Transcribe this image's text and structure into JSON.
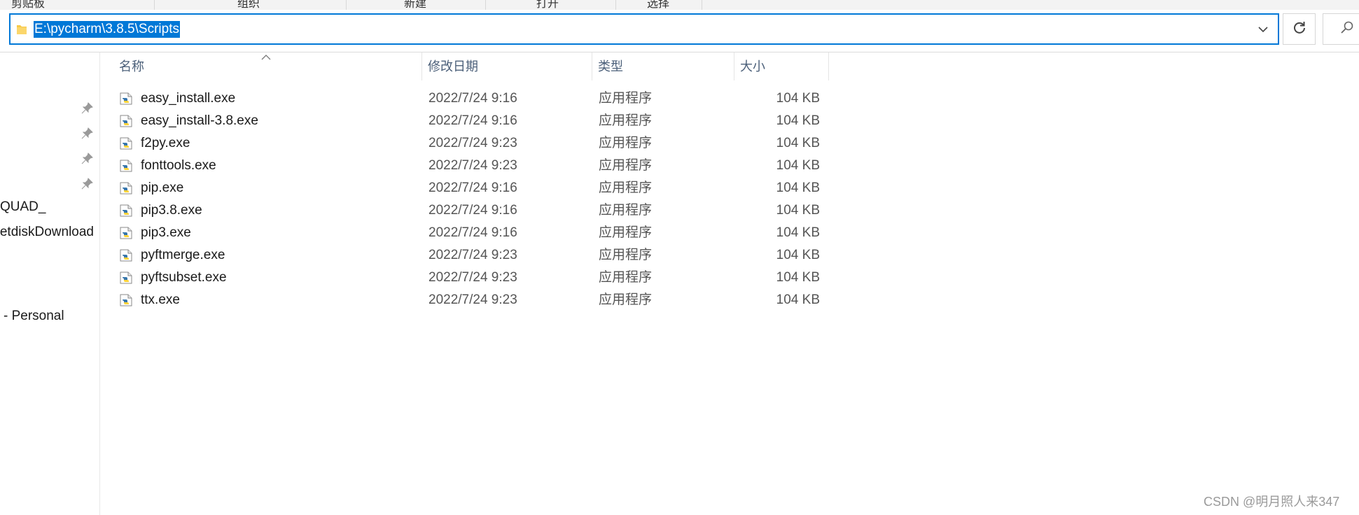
{
  "ribbon": {
    "groups": [
      "剪贴板",
      "组织",
      "新建",
      "打开",
      "选择"
    ]
  },
  "address_bar": {
    "path": "E:\\pycharm\\3.8.5\\Scripts"
  },
  "nav_pane": {
    "items": [
      "QUAD_",
      "etdiskDownload",
      "- Personal"
    ]
  },
  "file_list": {
    "columns": {
      "name": "名称",
      "modified": "修改日期",
      "type": "类型",
      "size": "大小"
    },
    "files": [
      {
        "name": "easy_install.exe",
        "modified": "2022/7/24 9:16",
        "type": "应用程序",
        "size": "104 KB"
      },
      {
        "name": "easy_install-3.8.exe",
        "modified": "2022/7/24 9:16",
        "type": "应用程序",
        "size": "104 KB"
      },
      {
        "name": "f2py.exe",
        "modified": "2022/7/24 9:23",
        "type": "应用程序",
        "size": "104 KB"
      },
      {
        "name": "fonttools.exe",
        "modified": "2022/7/24 9:23",
        "type": "应用程序",
        "size": "104 KB"
      },
      {
        "name": "pip.exe",
        "modified": "2022/7/24 9:16",
        "type": "应用程序",
        "size": "104 KB"
      },
      {
        "name": "pip3.8.exe",
        "modified": "2022/7/24 9:16",
        "type": "应用程序",
        "size": "104 KB"
      },
      {
        "name": "pip3.exe",
        "modified": "2022/7/24 9:16",
        "type": "应用程序",
        "size": "104 KB"
      },
      {
        "name": "pyftmerge.exe",
        "modified": "2022/7/24 9:23",
        "type": "应用程序",
        "size": "104 KB"
      },
      {
        "name": "pyftsubset.exe",
        "modified": "2022/7/24 9:23",
        "type": "应用程序",
        "size": "104 KB"
      },
      {
        "name": "ttx.exe",
        "modified": "2022/7/24 9:23",
        "type": "应用程序",
        "size": "104 KB"
      }
    ]
  },
  "watermark": "CSDN @明月照人来347",
  "icons": {
    "address_folder": "folder-icon",
    "address_dropdown": "chevron-down-icon",
    "refresh": "refresh-icon",
    "search": "search-icon",
    "nav_pin": "pin-icon",
    "file": "python-exe-icon"
  },
  "colors": {
    "accent": "#0078d7",
    "header_text": "#4c607a",
    "secondary_text": "#555555"
  }
}
